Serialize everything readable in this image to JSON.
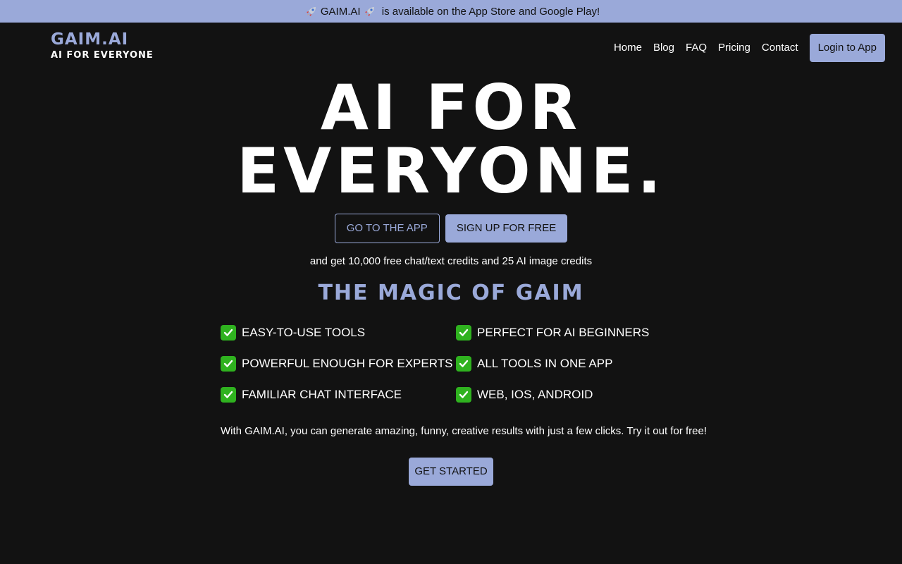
{
  "banner": {
    "prefix_icon": "rocket-icon",
    "brand": "GAIM.AI",
    "suffix_icon": "rocket-icon",
    "text": " is available on the App Store and Google Play!"
  },
  "brand": {
    "name": "GAIM.AI",
    "tagline": "AI FOR EVERYONE"
  },
  "nav": {
    "items": [
      "Home",
      "Blog",
      "FAQ",
      "Pricing",
      "Contact"
    ],
    "login_label": "Login to App"
  },
  "hero": {
    "line1": "AI FOR",
    "line2": "EVERYONE."
  },
  "cta": {
    "go_to_app": "GO TO THE APP",
    "sign_up": "SIGN UP FOR FREE",
    "credits_text": "and get 10,000 free chat/text credits and 25 AI image credits"
  },
  "magic": {
    "title": "THE MAGIC OF GAIM",
    "features": [
      "EASY-TO-USE TOOLS",
      "PERFECT FOR AI BEGINNERS",
      "POWERFUL ENOUGH FOR EXPERTS",
      "ALL TOOLS IN ONE APP",
      "FAMILIAR CHAT INTERFACE",
      "WEB, IOS, ANDROID"
    ],
    "feature_icon": "check-mark-icon"
  },
  "pitch": "With GAIM.AI, you can generate amazing, funny, creative results with just a few clicks. Try it out for free!",
  "get_started_label": "GET STARTED",
  "colors": {
    "accent": "#9aa9d9",
    "background": "#121212",
    "check": "#2fb21f"
  }
}
